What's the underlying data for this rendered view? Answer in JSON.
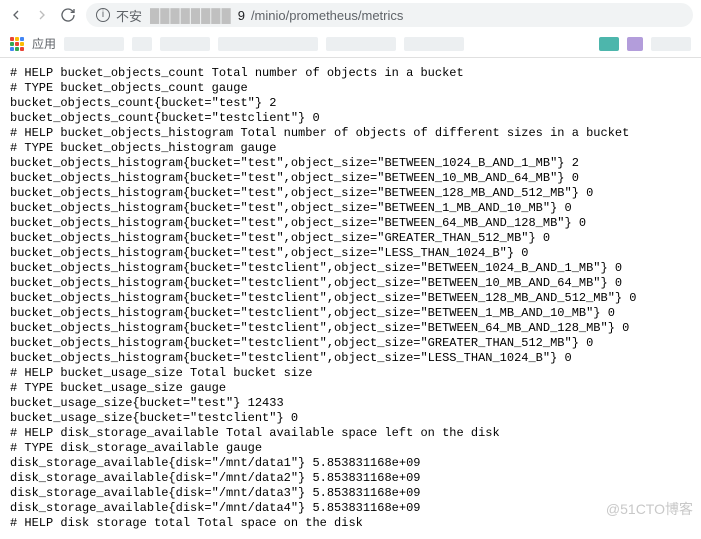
{
  "toolbar": {
    "insecure_label": "不安",
    "url_port": "9",
    "url_path": "/minio/prometheus/metrics"
  },
  "bookmarks": {
    "apps_label": "应用"
  },
  "metrics": {
    "lines": [
      "# HELP bucket_objects_count Total number of objects in a bucket",
      "# TYPE bucket_objects_count gauge",
      "bucket_objects_count{bucket=\"test\"} 2",
      "bucket_objects_count{bucket=\"testclient\"} 0",
      "# HELP bucket_objects_histogram Total number of objects of different sizes in a bucket",
      "# TYPE bucket_objects_histogram gauge",
      "bucket_objects_histogram{bucket=\"test\",object_size=\"BETWEEN_1024_B_AND_1_MB\"} 2",
      "bucket_objects_histogram{bucket=\"test\",object_size=\"BETWEEN_10_MB_AND_64_MB\"} 0",
      "bucket_objects_histogram{bucket=\"test\",object_size=\"BETWEEN_128_MB_AND_512_MB\"} 0",
      "bucket_objects_histogram{bucket=\"test\",object_size=\"BETWEEN_1_MB_AND_10_MB\"} 0",
      "bucket_objects_histogram{bucket=\"test\",object_size=\"BETWEEN_64_MB_AND_128_MB\"} 0",
      "bucket_objects_histogram{bucket=\"test\",object_size=\"GREATER_THAN_512_MB\"} 0",
      "bucket_objects_histogram{bucket=\"test\",object_size=\"LESS_THAN_1024_B\"} 0",
      "bucket_objects_histogram{bucket=\"testclient\",object_size=\"BETWEEN_1024_B_AND_1_MB\"} 0",
      "bucket_objects_histogram{bucket=\"testclient\",object_size=\"BETWEEN_10_MB_AND_64_MB\"} 0",
      "bucket_objects_histogram{bucket=\"testclient\",object_size=\"BETWEEN_128_MB_AND_512_MB\"} 0",
      "bucket_objects_histogram{bucket=\"testclient\",object_size=\"BETWEEN_1_MB_AND_10_MB\"} 0",
      "bucket_objects_histogram{bucket=\"testclient\",object_size=\"BETWEEN_64_MB_AND_128_MB\"} 0",
      "bucket_objects_histogram{bucket=\"testclient\",object_size=\"GREATER_THAN_512_MB\"} 0",
      "bucket_objects_histogram{bucket=\"testclient\",object_size=\"LESS_THAN_1024_B\"} 0",
      "# HELP bucket_usage_size Total bucket size",
      "# TYPE bucket_usage_size gauge",
      "bucket_usage_size{bucket=\"test\"} 12433",
      "bucket_usage_size{bucket=\"testclient\"} 0",
      "# HELP disk_storage_available Total available space left on the disk",
      "# TYPE disk_storage_available gauge",
      "disk_storage_available{disk=\"/mnt/data1\"} 5.853831168e+09",
      "disk_storage_available{disk=\"/mnt/data2\"} 5.853831168e+09",
      "disk_storage_available{disk=\"/mnt/data3\"} 5.853831168e+09",
      "disk_storage_available{disk=\"/mnt/data4\"} 5.853831168e+09",
      "# HELP disk storage total Total space on the disk"
    ]
  },
  "watermark": "@51CTO博客"
}
